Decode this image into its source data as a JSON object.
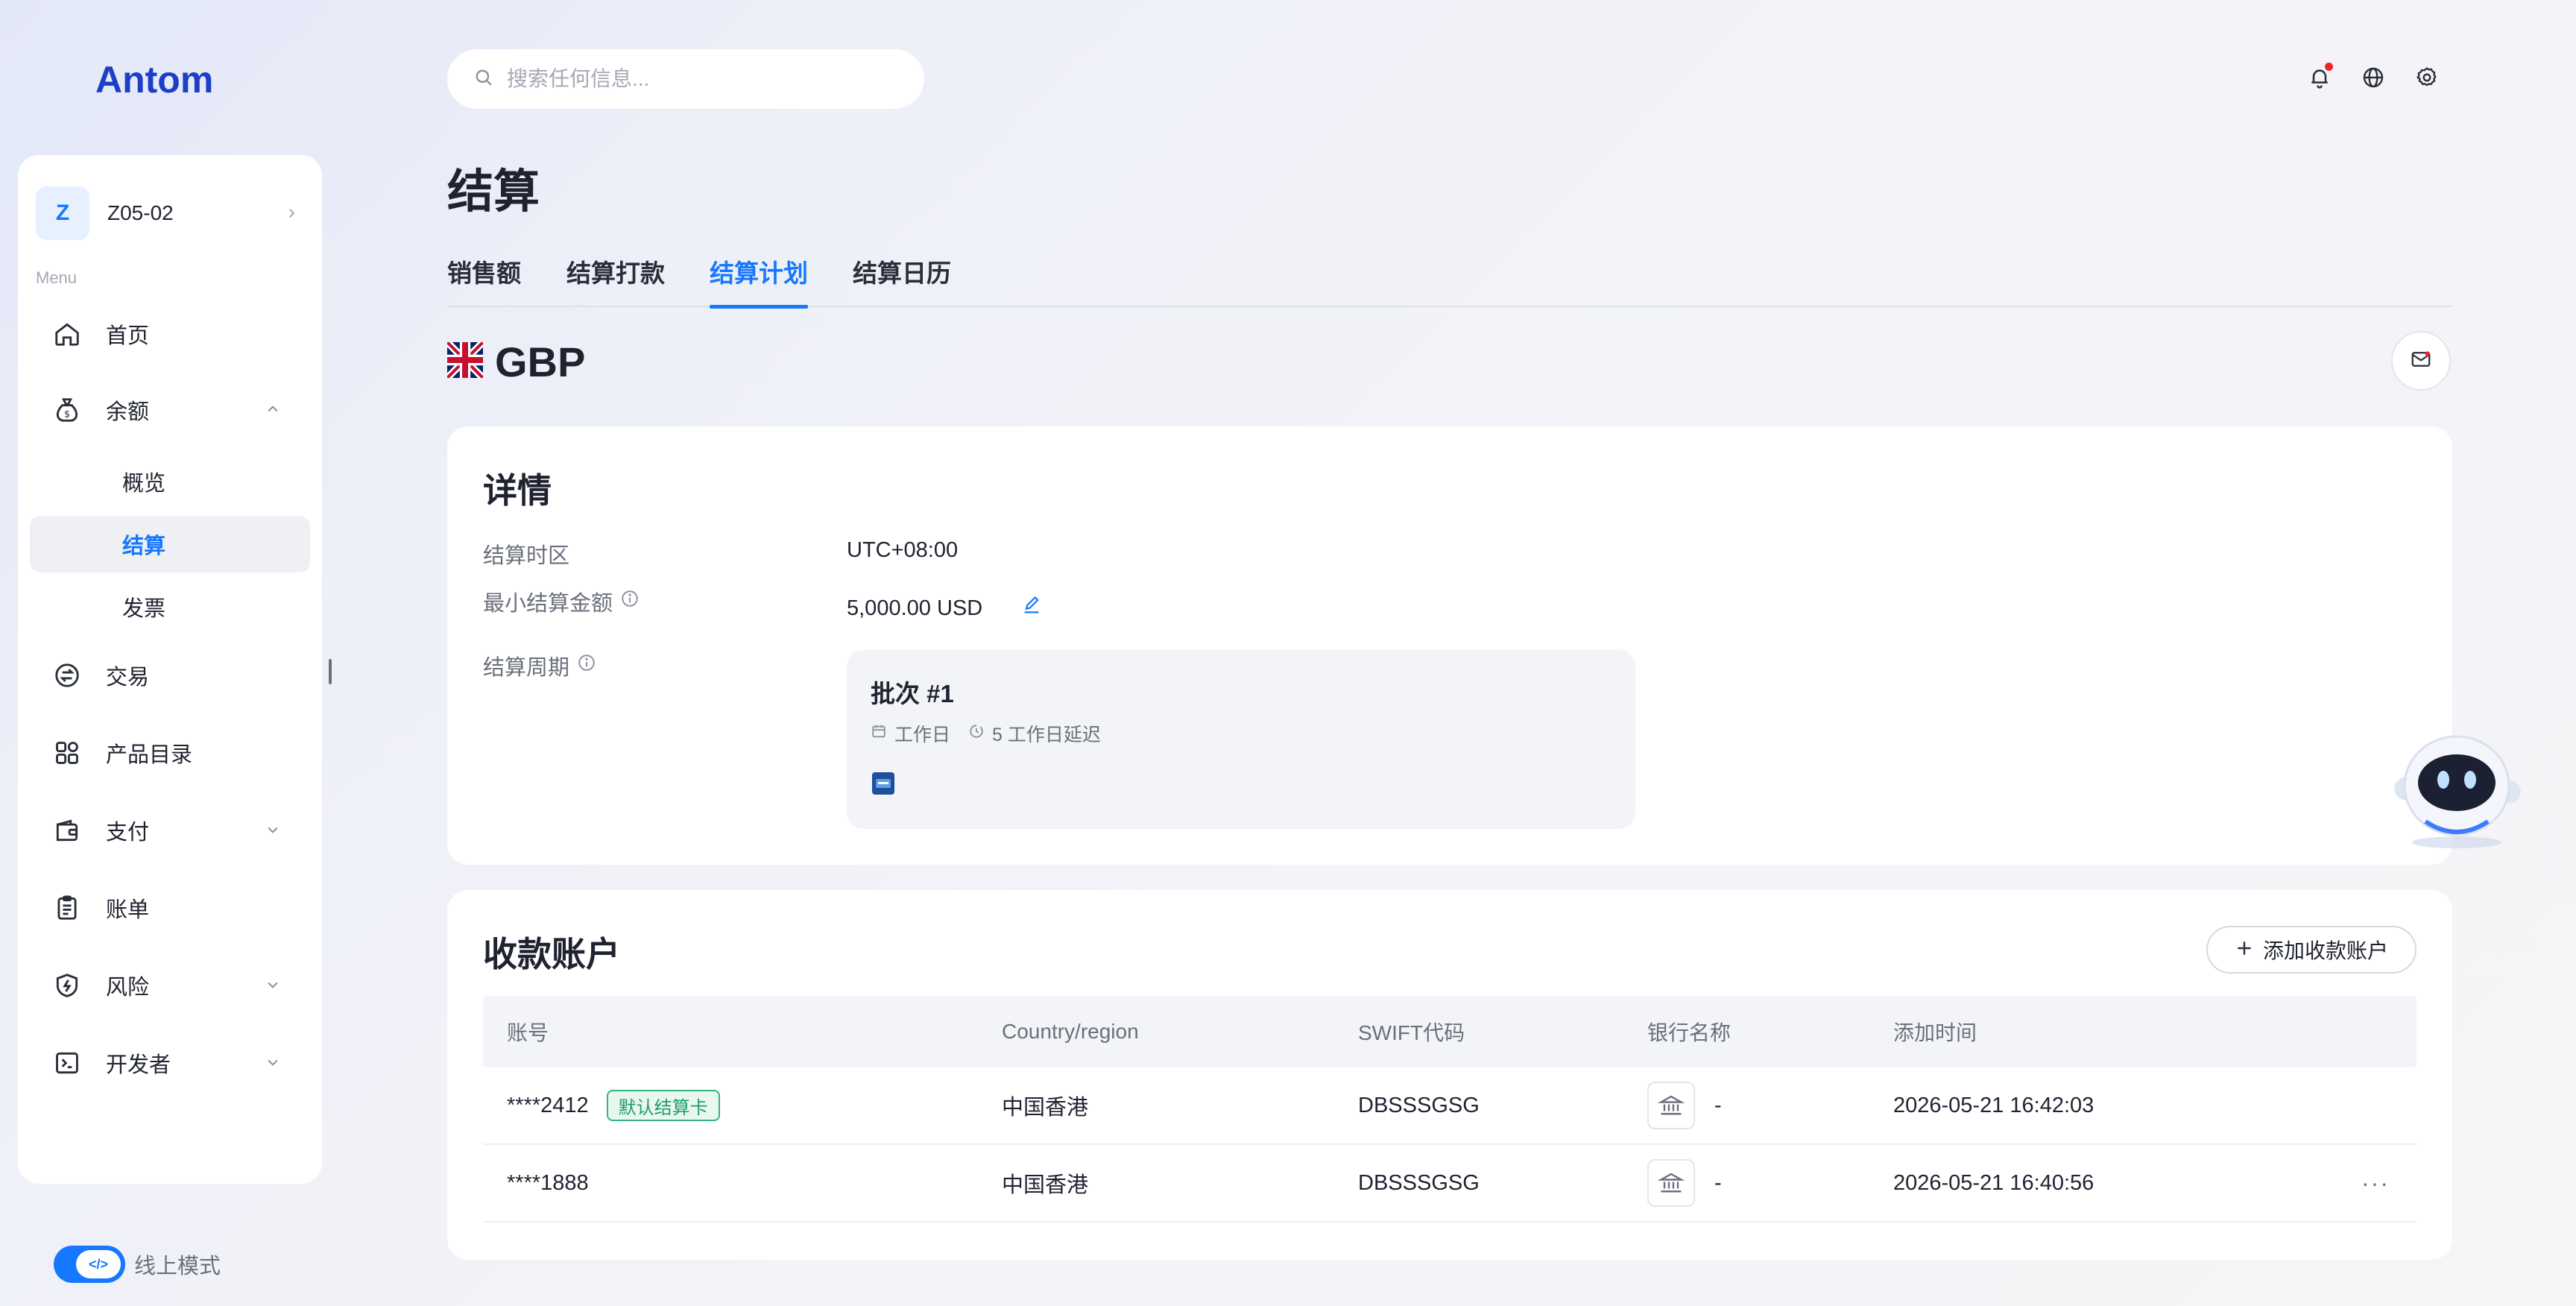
{
  "brand": {
    "logo_text": "Antom",
    "accent": "#1677ff"
  },
  "search": {
    "placeholder": "搜索任何信息..."
  },
  "sidebar": {
    "account": {
      "initial": "Z",
      "name": "Z05-02"
    },
    "menu_caption": "Menu",
    "items": [
      {
        "label": "首页",
        "icon": "home-icon"
      },
      {
        "label": "余额",
        "icon": "money-bag-icon",
        "expanded": true,
        "children": [
          {
            "label": "概览"
          },
          {
            "label": "结算",
            "active": true
          },
          {
            "label": "发票"
          }
        ]
      },
      {
        "label": "交易",
        "icon": "exchange-icon"
      },
      {
        "label": "产品目录",
        "icon": "catalog-icon"
      },
      {
        "label": "支付",
        "icon": "wallet-icon",
        "expandable": true
      },
      {
        "label": "账单",
        "icon": "bill-icon"
      },
      {
        "label": "风险",
        "icon": "shield-icon",
        "expandable": true
      },
      {
        "label": "开发者",
        "icon": "terminal-icon",
        "expandable": true
      }
    ],
    "mode": {
      "label": "线上模式",
      "enabled": true,
      "knob_text": "</>"
    }
  },
  "page": {
    "title": "结算",
    "tabs": [
      {
        "label": "销售额"
      },
      {
        "label": "结算打款"
      },
      {
        "label": "结算计划",
        "active": true
      },
      {
        "label": "结算日历"
      }
    ],
    "currency": "GBP"
  },
  "details": {
    "title": "详情",
    "timezone_label": "结算时区",
    "timezone_value": "UTC+08:00",
    "min_amount_label": "最小结算金额",
    "min_amount_value": "5,000.00 USD",
    "cycle_label": "结算周期",
    "batch": {
      "title": "批次 #1",
      "day_type": "工作日",
      "delay": "5 工作日延迟"
    }
  },
  "payee_accounts": {
    "title": "收款账户",
    "add_button": "添加收款账户",
    "columns": [
      "账号",
      "Country/region",
      "SWIFT代码",
      "银行名称",
      "添加时间"
    ],
    "rows": [
      {
        "account": "****2412",
        "badge": "默认结算卡",
        "region": "中国香港",
        "swift": "DBSSSGSG",
        "bank": "-",
        "added": "2026-05-21 16:42:03"
      },
      {
        "account": "****1888",
        "badge": "",
        "region": "中国香港",
        "swift": "DBSSSGSG",
        "bank": "-",
        "added": "2026-05-21 16:40:56",
        "more": "···"
      }
    ]
  }
}
